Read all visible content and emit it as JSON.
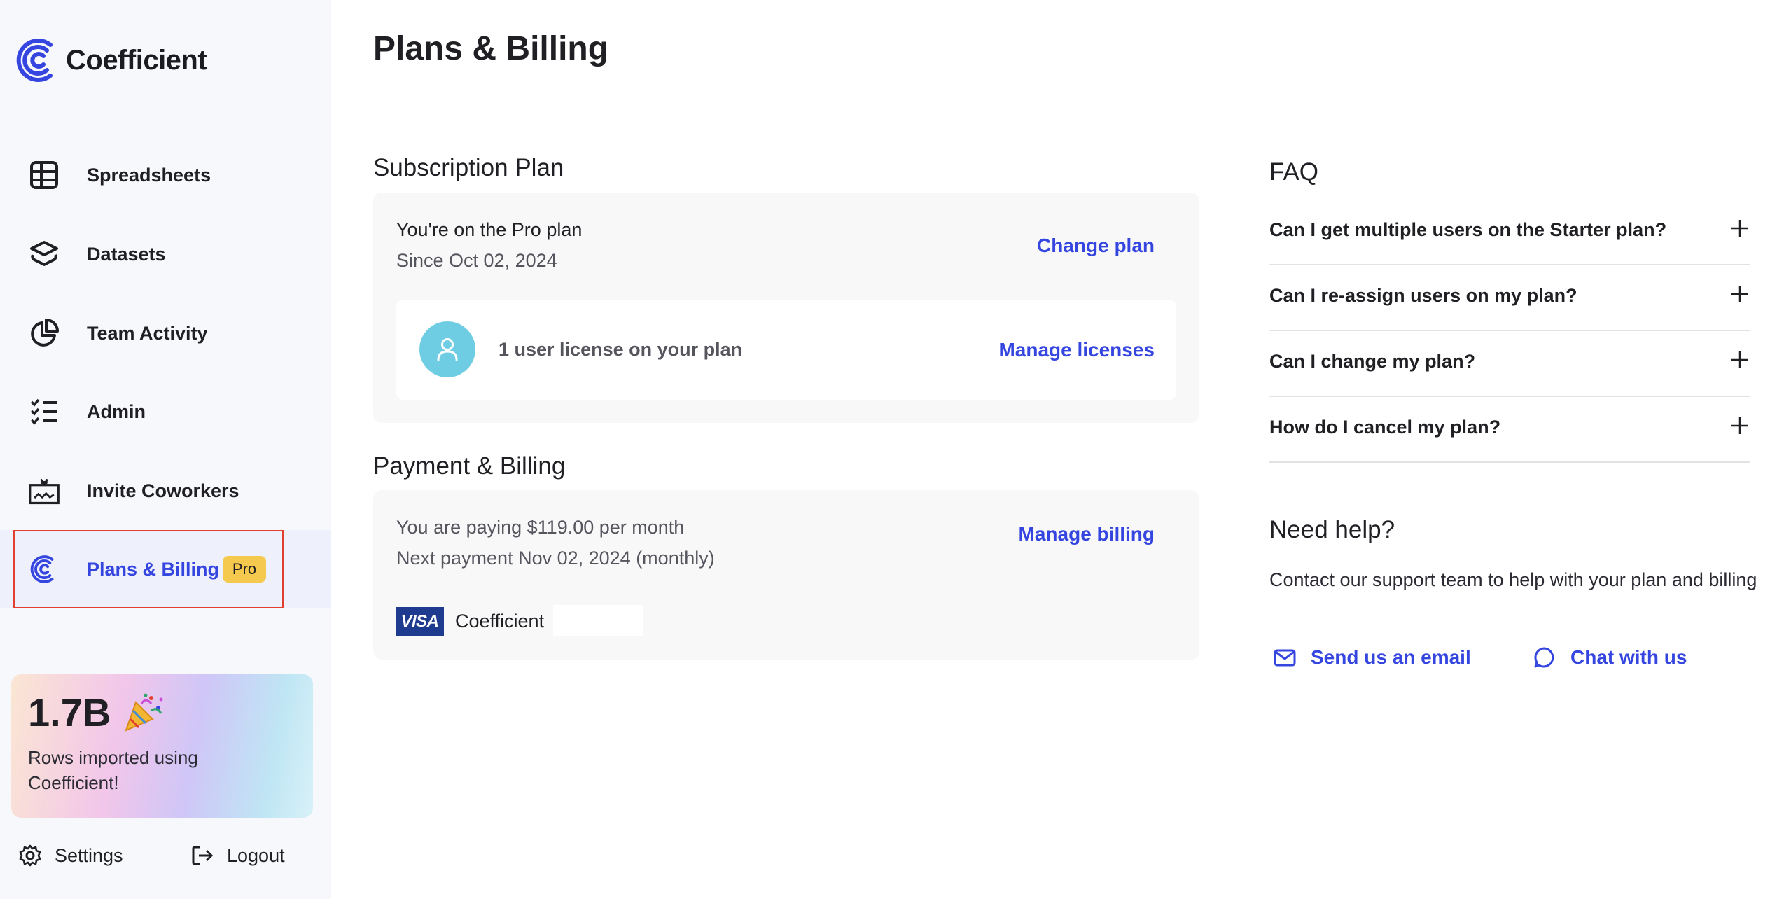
{
  "brand": {
    "name": "Coefficient",
    "accent": "#3546e0"
  },
  "sidebar": {
    "items": [
      {
        "label": "Spreadsheets",
        "icon": "table-icon"
      },
      {
        "label": "Datasets",
        "icon": "layers-icon"
      },
      {
        "label": "Team Activity",
        "icon": "pie-chart-icon"
      },
      {
        "label": "Admin",
        "icon": "checklist-icon"
      },
      {
        "label": "Invite Coworkers",
        "icon": "gift-icon"
      },
      {
        "label": "Plans & Billing",
        "icon": "coefficient-logo-icon",
        "badge": "Pro",
        "active": true
      }
    ],
    "promo": {
      "number": "1.7B",
      "emoji": "party-popper-icon",
      "text": "Rows imported using Coefficient!"
    },
    "settings_label": "Settings",
    "logout_label": "Logout"
  },
  "main": {
    "title": "Plans & Billing",
    "subscription": {
      "section_title": "Subscription Plan",
      "plan_text": "You're on the Pro plan",
      "since_text": "Since Oct 02, 2024",
      "change_plan_label": "Change plan",
      "license_text": "1 user license on your plan",
      "manage_licenses_label": "Manage licenses"
    },
    "payment": {
      "section_title": "Payment & Billing",
      "paying_text": "You are paying $119.00 per month",
      "next_payment_text": "Next payment Nov 02, 2024 (monthly)",
      "manage_billing_label": "Manage billing",
      "card_brand": "VISA",
      "card_name": "Coefficient"
    }
  },
  "faq": {
    "title": "FAQ",
    "items": [
      {
        "question": "Can I get multiple users on the Starter plan?"
      },
      {
        "question": "Can I re-assign users on my plan?"
      },
      {
        "question": "Can I change my plan?"
      },
      {
        "question": "How do I cancel my plan?"
      }
    ]
  },
  "help": {
    "title": "Need help?",
    "text": "Contact our support team to help with your plan and billing",
    "email_label": "Send us an email",
    "chat_label": "Chat with us"
  }
}
